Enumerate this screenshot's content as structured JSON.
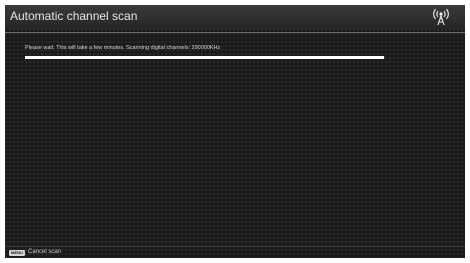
{
  "header": {
    "title": "Automatic channel scan",
    "icon": "antenna-icon"
  },
  "scan": {
    "status": "Please wait. This will take a few minutes. Scanning digital channels: 290000KHz",
    "progress": 0.997
  },
  "footer": {
    "key_label": "MENU",
    "action_label": "Cancel scan"
  },
  "colors": {
    "background": "#1b1b1b",
    "progress_fill": "#ffffff",
    "text": "#e6e6e6"
  }
}
